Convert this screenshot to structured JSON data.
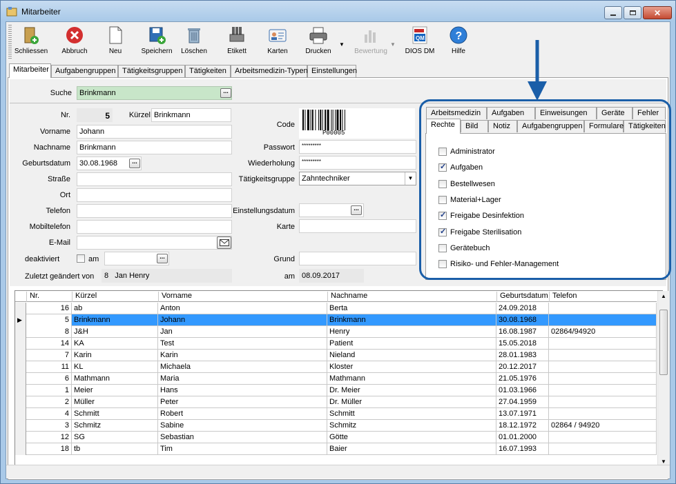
{
  "window": {
    "title": "Mitarbeiter"
  },
  "toolbar": [
    {
      "label": "Schliessen",
      "icon": "exit-door-icon",
      "disabled": false
    },
    {
      "label": "Abbruch",
      "icon": "cancel-icon",
      "disabled": false
    },
    {
      "label": "Neu",
      "icon": "new-document-icon",
      "disabled": false
    },
    {
      "label": "Speichern",
      "icon": "save-icon",
      "disabled": false
    },
    {
      "label": "Löschen",
      "icon": "trash-icon",
      "disabled": false
    },
    {
      "label": "Etikett",
      "icon": "label-printer-icon",
      "disabled": false
    },
    {
      "label": "Karten",
      "icon": "id-card-icon",
      "disabled": false
    },
    {
      "label": "Drucken",
      "icon": "printer-icon",
      "disabled": false
    },
    {
      "label": "Bewertung",
      "icon": "rating-chart-icon",
      "disabled": true
    },
    {
      "label": "DIOS DM",
      "icon": "pdf-qm-icon",
      "disabled": false
    },
    {
      "label": "Hilfe",
      "icon": "help-icon",
      "disabled": false
    }
  ],
  "main_tabs": [
    "Mitarbeiter",
    "Aufgabengruppen",
    "Tätigkeitsgruppen",
    "Tätigkeiten",
    "Arbeitsmedizin-Typen",
    "Einstellungen"
  ],
  "search": {
    "label": "Suche",
    "value": "Brinkmann"
  },
  "form": {
    "nr_label": "Nr.",
    "nr": "5",
    "kuerzel_label": "Kürzel",
    "kuerzel": "Brinkmann",
    "vorname_label": "Vorname",
    "vorname": "Johann",
    "nachname_label": "Nachname",
    "nachname": "Brinkmann",
    "geburtsdatum_label": "Geburtsdatum",
    "geburtsdatum": "30.08.1968",
    "strasse_label": "Straße",
    "strasse": "",
    "ort_label": "Ort",
    "ort": "",
    "telefon_label": "Telefon",
    "telefon": "",
    "mobil_label": "Mobiltelefon",
    "mobil": "",
    "email_label": "E-Mail",
    "email": "",
    "deaktiviert_label": "deaktiviert",
    "am_label": "am",
    "deaktiviert_am": "",
    "changed_label": "Zuletzt geändert von",
    "changed_nr": "8",
    "changed_name": "Jan Henry",
    "changed_am_label": "am",
    "changed_am": "08.09.2017",
    "code_label": "Code",
    "barcode_text": "P00005",
    "passwort_label": "Passwort",
    "passwort": "*********",
    "wiederholung_label": "Wiederholung",
    "wiederholung": "*********",
    "taetigkeitsgruppe_label": "Tätigkeitsgruppe",
    "taetigkeitsgruppe": "Zahntechniker",
    "einstellung_label": "Einstellungsdatum",
    "einstellung": "",
    "karte_label": "Karte",
    "karte": "",
    "grund_label": "Grund",
    "grund": ""
  },
  "rights_tabs_back": [
    "Arbeitsmedizin",
    "Aufgaben",
    "Einweisungen",
    "Geräte",
    "Fehler"
  ],
  "rights_tabs_front": [
    "Rechte",
    "Bild",
    "Notiz",
    "Aufgabengruppen",
    "Formulare",
    "Tätigkeiten"
  ],
  "rights": [
    {
      "label": "Administrator",
      "checked": false
    },
    {
      "label": "Aufgaben",
      "checked": true
    },
    {
      "label": "Bestellwesen",
      "checked": false
    },
    {
      "label": "Material+Lager",
      "checked": false
    },
    {
      "label": "Freigabe Desinfektion",
      "checked": true
    },
    {
      "label": "Freigabe Sterilisation",
      "checked": true
    },
    {
      "label": "Gerätebuch",
      "checked": false
    },
    {
      "label": "Risiko- und Fehler-Management",
      "checked": false
    }
  ],
  "grid": {
    "columns": [
      "Nr.",
      "Kürzel",
      "Vorname",
      "Nachname",
      "Geburtsdatum",
      "Telefon"
    ],
    "selected_index": 1,
    "rows": [
      [
        "16",
        "ab",
        "Anton",
        "Berta",
        "24.09.2018",
        ""
      ],
      [
        "5",
        "Brinkmann",
        "Johann",
        "Brinkmann",
        "30.08.1968",
        ""
      ],
      [
        "8",
        "J&H",
        "Jan",
        "Henry",
        "16.08.1987",
        "02864/94920"
      ],
      [
        "14",
        "KA",
        "Test",
        "Patient",
        "15.05.2018",
        ""
      ],
      [
        "7",
        "Karin",
        "Karin",
        "Nieland",
        "28.01.1983",
        ""
      ],
      [
        "11",
        "KL",
        "Michaela",
        "Kloster",
        "20.12.2017",
        ""
      ],
      [
        "6",
        "Mathmann",
        "Maria",
        "Mathmann",
        "21.05.1976",
        ""
      ],
      [
        "1",
        "Meier",
        "Hans",
        "Dr. Meier",
        "01.03.1966",
        ""
      ],
      [
        "2",
        "Müller",
        "Peter",
        "Dr. Müller",
        "27.04.1959",
        ""
      ],
      [
        "4",
        "Schmitt",
        "Robert",
        "Schmitt",
        "13.07.1971",
        ""
      ],
      [
        "3",
        "Schmitz",
        "Sabine",
        "Schmitz",
        "18.12.1972",
        "02864 / 94920"
      ],
      [
        "12",
        "SG",
        "Sebastian",
        "Götte",
        "01.01.2000",
        ""
      ],
      [
        "18",
        "tb",
        "Tim",
        "Baier",
        "16.07.1993",
        ""
      ]
    ]
  },
  "colors": {
    "accent": "#1a5ea8",
    "selection": "#3399ff",
    "search_bg": "#c8e6c9"
  }
}
